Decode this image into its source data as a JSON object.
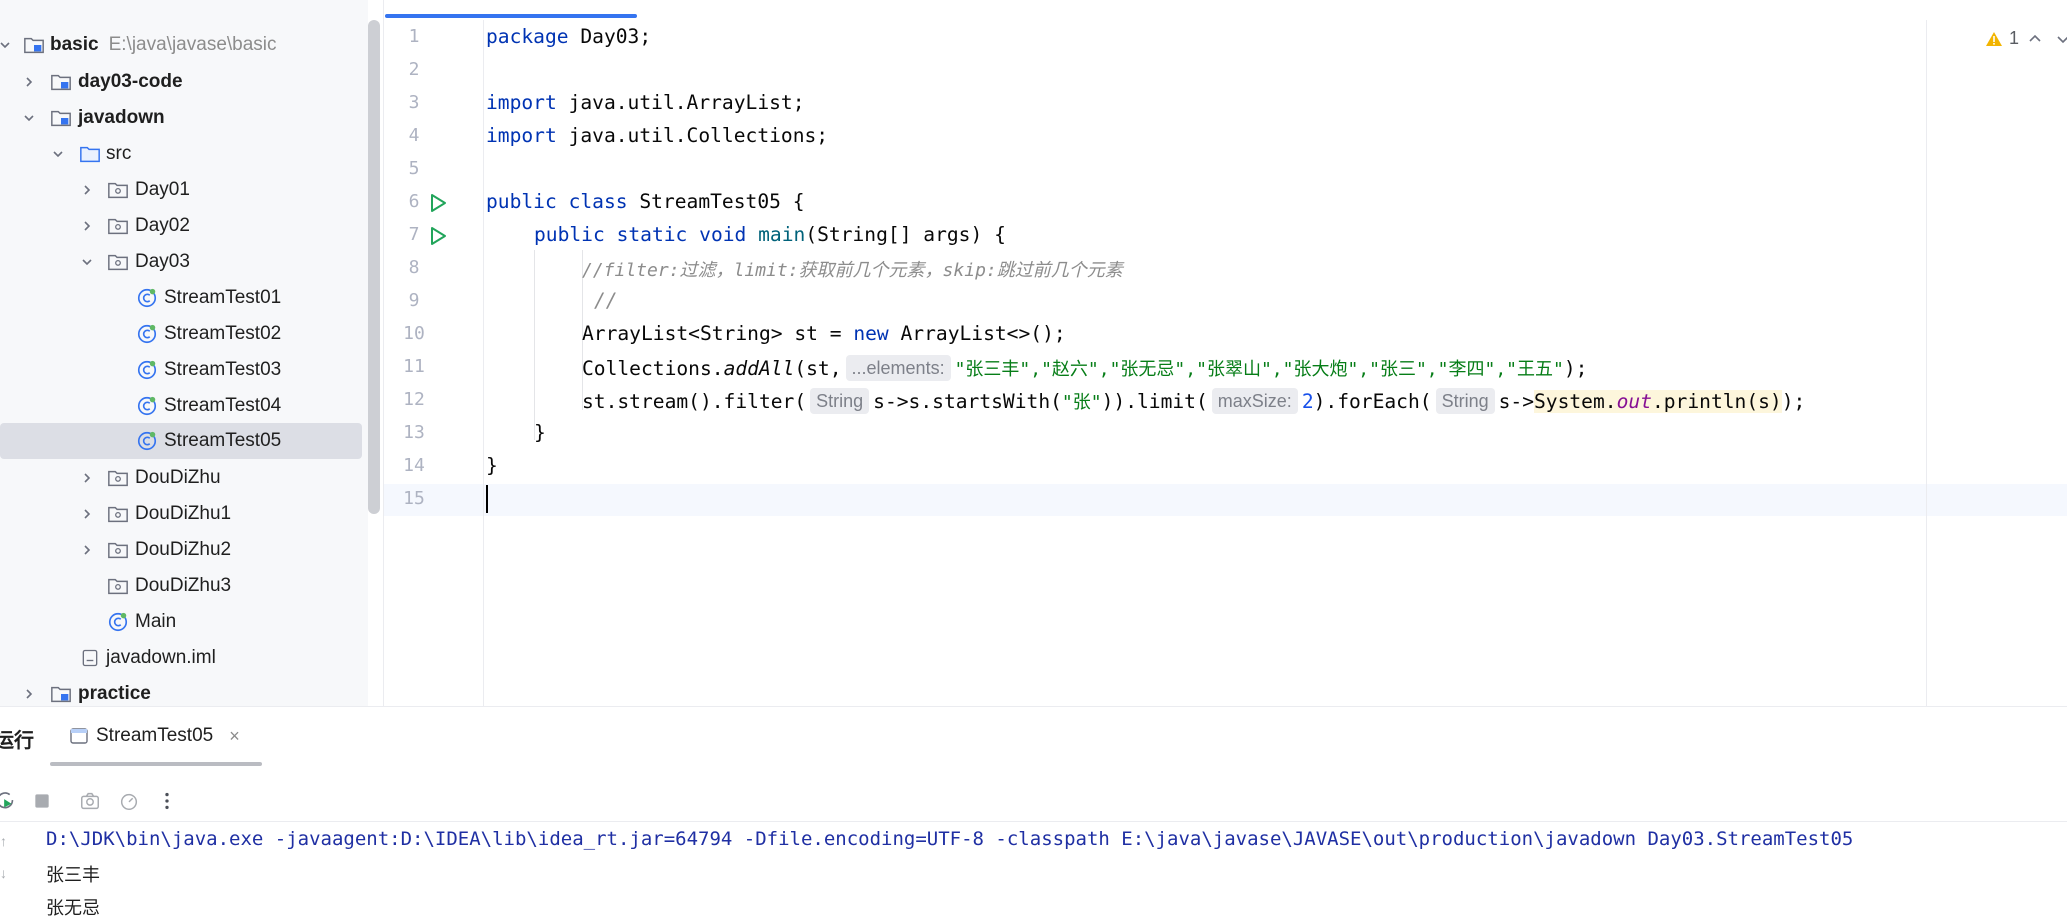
{
  "project_tree": {
    "root": {
      "name": "basic",
      "path": "E:\\java\\javase\\basic"
    },
    "items": [
      {
        "label": "day03-code",
        "bold": true
      },
      {
        "label": "javadown",
        "bold": true
      },
      {
        "label": "src"
      },
      {
        "label": "Day01"
      },
      {
        "label": "Day02"
      },
      {
        "label": "Day03"
      },
      {
        "label": "StreamTest01"
      },
      {
        "label": "StreamTest02"
      },
      {
        "label": "StreamTest03"
      },
      {
        "label": "StreamTest04"
      },
      {
        "label": "StreamTest05",
        "selected": true
      },
      {
        "label": "DouDiZhu"
      },
      {
        "label": "DouDiZhu1"
      },
      {
        "label": "DouDiZhu2"
      },
      {
        "label": "DouDiZhu3"
      },
      {
        "label": "Main"
      },
      {
        "label": "javadown.iml"
      },
      {
        "label": "practice",
        "bold": true
      }
    ]
  },
  "editor": {
    "warning_count": "1",
    "line_numbers": [
      "1",
      "2",
      "3",
      "4",
      "5",
      "6",
      "7",
      "8",
      "9",
      "10",
      "11",
      "12",
      "13",
      "14",
      "15"
    ],
    "code": {
      "l1_kw": "package",
      "l1_rest": " Day03;",
      "l3_kw": "import",
      "l3_rest": " java.util.ArrayList;",
      "l4_kw": "import",
      "l4_rest": " java.util.Collections;",
      "l6_kw": "public class",
      "l6_rest": " StreamTest05 {",
      "l7_kw": "public static void",
      "l7_fn": "main",
      "l7_rest": "(String[] args) {",
      "l8_comment": "//filter:过滤，limit:获取前几个元素，skip:跳过前几个元素",
      "l9_comment": "//",
      "l10_a": "ArrayList<String> st = ",
      "l10_kw": "new",
      "l10_b": " ArrayList<>();",
      "l11_a": "Collections.",
      "l11_method": "addAll",
      "l11_b": "(st,",
      "l11_hint": "...elements:",
      "l11_str": "\"张三丰\",\"赵六\",\"张无忌\",\"张翠山\",\"张大炮\",\"张三\",\"李四\",\"王五\"",
      "l11_end": ");",
      "l12_a": "st.stream().filter(",
      "l12_hint1": "String",
      "l12_b": "s->s.startsWith(",
      "l12_str": "\"张\"",
      "l12_c": ")).limit(",
      "l12_hint2": "maxSize:",
      "l12_num": "2",
      "l12_d": ").forEach(",
      "l12_hint3": "String",
      "l12_e": "s->",
      "l12_hl1": "System.",
      "l12_out": "out",
      "l12_hl2": ".println(s)",
      "l12_end": ");",
      "l13": "}",
      "l14": "}"
    }
  },
  "run_panel": {
    "title": "运行",
    "tab_label": "StreamTest05",
    "close_glyph": "×",
    "console_lines": [
      "D:\\JDK\\bin\\java.exe -javaagent:D:\\IDEA\\lib\\idea_rt.jar=64794 -Dfile.encoding=UTF-8 -classpath E:\\java\\javase\\JAVASE\\out\\production\\javadown Day03.StreamTest05",
      "张三丰",
      "张无忌"
    ]
  },
  "icons": {
    "folder": "folder-icon",
    "module": "module-folder-icon",
    "package": "package-icon",
    "class": "java-class-icon",
    "iml": "iml-file-icon",
    "run": "run-gutter-icon",
    "warning": "warning-icon"
  },
  "colors": {
    "keyword": "#0033b3",
    "string": "#067d17",
    "comment": "#8c8c8c",
    "selection": "#dcdee5",
    "accent": "#3574f0",
    "console_command": "#1f2fa3"
  }
}
